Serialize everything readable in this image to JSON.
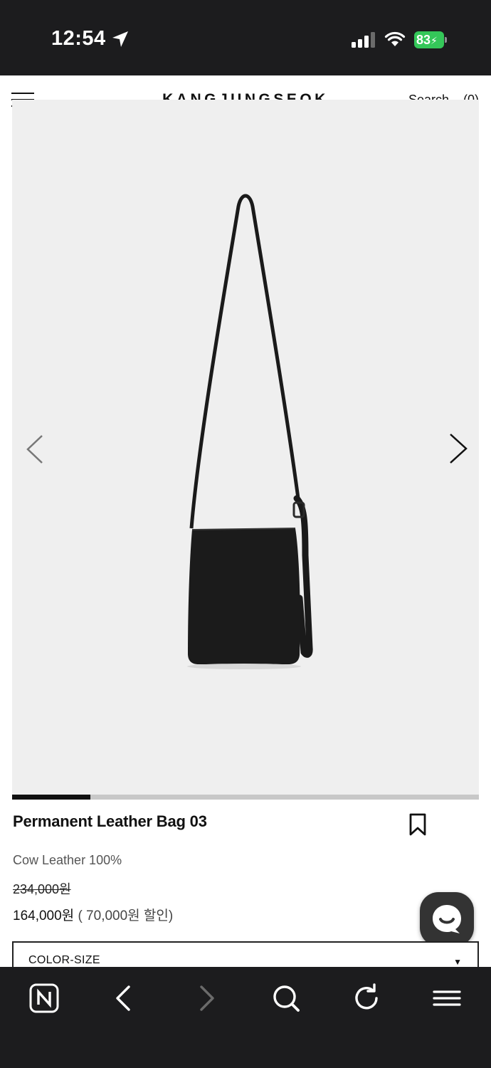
{
  "status_bar": {
    "time": "12:54",
    "battery": "83",
    "icons": [
      "location-arrow-icon",
      "signal-icon",
      "wifi-icon",
      "battery-charging-icon"
    ]
  },
  "header": {
    "brand": "KANGJUNGSEOK",
    "search_label": "Search",
    "cart_count": "(0)",
    "menu_icon": "hamburger-menu-icon"
  },
  "gallery": {
    "background": "#efefef",
    "prev_icon": "chevron-left-icon",
    "next_icon": "chevron-right-icon",
    "progress": 0.167
  },
  "product": {
    "name": "Permanent Leather Bag 03",
    "material": "Cow Leather 100%",
    "original_price": "234,000원",
    "sale_price": "164,000원",
    "discount": "( 70,000원 할인)"
  },
  "options": {
    "label": "COLOR-SIZE",
    "caret": "▼"
  },
  "toolbar": {
    "items": [
      "naver-home-icon",
      "back-icon",
      "forward-icon",
      "search-icon",
      "reload-icon",
      "menu-icon"
    ]
  },
  "colors": {
    "system_bar": "#1c1c1e",
    "battery_green": "#34c759",
    "chat_button": "#333333"
  }
}
